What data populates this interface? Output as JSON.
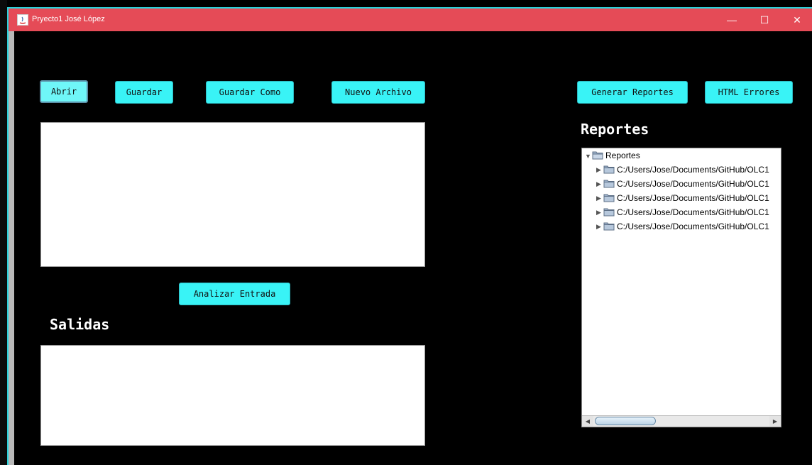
{
  "window": {
    "title": "Pryecto1 José López",
    "min_glyph": "—",
    "max_glyph": "☐",
    "close_glyph": "✕"
  },
  "toolbar": {
    "open_label": "Abrir",
    "save_label": "Guardar",
    "save_as_label": "Guardar Como",
    "new_file_label": "Nuevo Archivo",
    "generate_reports_label": "Generar Reportes",
    "html_errors_label": "HTML Errores"
  },
  "analyze_label": "Analizar Entrada",
  "outputs_heading": "Salidas",
  "reports_heading": "Reportes",
  "tree": {
    "root": "Reportes",
    "children": [
      "C:/Users/Jose/Documents/GitHub/OLC1",
      "C:/Users/Jose/Documents/GitHub/OLC1",
      "C:/Users/Jose/Documents/GitHub/OLC1",
      "C:/Users/Jose/Documents/GitHub/OLC1",
      "C:/Users/Jose/Documents/GitHub/OLC1"
    ]
  },
  "colors": {
    "titlebar": "#e54b57",
    "button": "#39f3f6",
    "background": "#000000",
    "accent_border": "#29d3dc"
  }
}
